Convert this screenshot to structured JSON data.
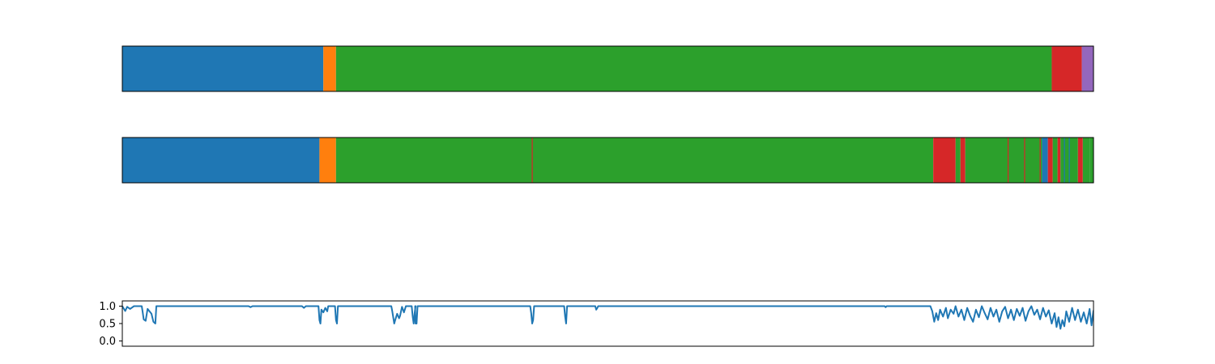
{
  "colors": {
    "blue": "#1f77b4",
    "orange": "#ff7f0e",
    "green": "#2ca02c",
    "red": "#d62728",
    "purple": "#9467bd",
    "frame": "#000000"
  },
  "chart_data": [
    {
      "type": "state-sequence",
      "xlim": [
        0,
        1
      ],
      "segments": [
        {
          "start": 0.0,
          "end": 0.207,
          "color": "blue"
        },
        {
          "start": 0.207,
          "end": 0.22,
          "color": "orange"
        },
        {
          "start": 0.22,
          "end": 0.957,
          "color": "green"
        },
        {
          "start": 0.957,
          "end": 0.988,
          "color": "red"
        },
        {
          "start": 0.988,
          "end": 1.0,
          "color": "purple"
        }
      ],
      "axes_visible": false
    },
    {
      "type": "state-sequence",
      "xlim": [
        0,
        1
      ],
      "segments": [
        {
          "start": 0.0,
          "end": 0.203,
          "color": "blue"
        },
        {
          "start": 0.203,
          "end": 0.22,
          "color": "orange"
        },
        {
          "start": 0.22,
          "end": 0.835,
          "color": "green"
        },
        {
          "start": 0.835,
          "end": 0.858,
          "color": "red"
        },
        {
          "start": 0.858,
          "end": 0.863,
          "color": "green"
        },
        {
          "start": 0.863,
          "end": 0.868,
          "color": "red"
        },
        {
          "start": 0.868,
          "end": 0.947,
          "color": "green"
        },
        {
          "start": 0.947,
          "end": 0.953,
          "color": "blue"
        },
        {
          "start": 0.953,
          "end": 0.958,
          "color": "red"
        },
        {
          "start": 0.958,
          "end": 0.963,
          "color": "green"
        },
        {
          "start": 0.963,
          "end": 0.966,
          "color": "red"
        },
        {
          "start": 0.966,
          "end": 0.984,
          "color": "green"
        },
        {
          "start": 0.984,
          "end": 0.989,
          "color": "red"
        },
        {
          "start": 0.989,
          "end": 0.996,
          "color": "green"
        },
        {
          "start": 0.996,
          "end": 1.0,
          "color": "green"
        }
      ],
      "thin_marks": [
        {
          "x": 0.422,
          "color": "red"
        },
        {
          "x": 0.912,
          "color": "red"
        },
        {
          "x": 0.929,
          "color": "red"
        },
        {
          "x": 0.945,
          "color": "red"
        },
        {
          "x": 0.97,
          "color": "blue"
        },
        {
          "x": 0.975,
          "color": "blue"
        }
      ],
      "axes_visible": false
    },
    {
      "type": "line",
      "xlim": [
        0,
        1
      ],
      "ylim": [
        -0.15,
        1.15
      ],
      "yticks": [
        "0.0",
        "0.5",
        "1.0"
      ],
      "ytick_values": [
        0.0,
        0.5,
        1.0
      ],
      "series": [
        {
          "color": "blue",
          "points": [
            [
              0.0,
              1.0
            ],
            [
              0.003,
              0.86
            ],
            [
              0.005,
              0.98
            ],
            [
              0.008,
              0.92
            ],
            [
              0.012,
              1.0
            ],
            [
              0.02,
              1.0
            ],
            [
              0.021,
              0.82
            ],
            [
              0.022,
              0.62
            ],
            [
              0.024,
              0.58
            ],
            [
              0.026,
              0.92
            ],
            [
              0.03,
              0.78
            ],
            [
              0.032,
              0.55
            ],
            [
              0.034,
              0.5
            ],
            [
              0.035,
              1.0
            ],
            [
              0.13,
              1.0
            ],
            [
              0.132,
              0.97
            ],
            [
              0.134,
              1.0
            ],
            [
              0.185,
              1.0
            ],
            [
              0.187,
              0.95
            ],
            [
              0.189,
              1.0
            ],
            [
              0.202,
              1.0
            ],
            [
              0.203,
              0.6
            ],
            [
              0.204,
              0.5
            ],
            [
              0.205,
              0.9
            ],
            [
              0.207,
              0.82
            ],
            [
              0.209,
              0.95
            ],
            [
              0.211,
              0.85
            ],
            [
              0.212,
              1.0
            ],
            [
              0.219,
              1.0
            ],
            [
              0.22,
              0.6
            ],
            [
              0.221,
              0.5
            ],
            [
              0.222,
              1.0
            ],
            [
              0.277,
              1.0
            ],
            [
              0.278,
              0.85
            ],
            [
              0.28,
              0.5
            ],
            [
              0.281,
              0.6
            ],
            [
              0.283,
              0.78
            ],
            [
              0.285,
              0.65
            ],
            [
              0.286,
              0.72
            ],
            [
              0.288,
              0.98
            ],
            [
              0.29,
              0.82
            ],
            [
              0.292,
              1.0
            ],
            [
              0.298,
              1.0
            ],
            [
              0.299,
              0.7
            ],
            [
              0.3,
              0.5
            ],
            [
              0.301,
              0.8
            ],
            [
              0.302,
              1.0
            ],
            [
              0.3015,
              1.0
            ],
            [
              0.302,
              0.5
            ],
            [
              0.303,
              0.5
            ],
            [
              0.304,
              1.0
            ],
            [
              0.42,
              1.0
            ],
            [
              0.421,
              0.8
            ],
            [
              0.422,
              0.5
            ],
            [
              0.423,
              0.6
            ],
            [
              0.424,
              1.0
            ],
            [
              0.455,
              1.0
            ],
            [
              0.456,
              0.7
            ],
            [
              0.457,
              0.5
            ],
            [
              0.458,
              1.0
            ],
            [
              0.487,
              1.0
            ],
            [
              0.488,
              0.9
            ],
            [
              0.489,
              0.94
            ],
            [
              0.49,
              1.0
            ],
            [
              0.785,
              1.0
            ],
            [
              0.786,
              0.97
            ],
            [
              0.787,
              1.0
            ],
            [
              0.832,
              1.0
            ],
            [
              0.834,
              0.85
            ],
            [
              0.836,
              0.55
            ],
            [
              0.838,
              0.8
            ],
            [
              0.84,
              0.6
            ],
            [
              0.842,
              0.9
            ],
            [
              0.845,
              0.7
            ],
            [
              0.848,
              0.95
            ],
            [
              0.85,
              0.65
            ],
            [
              0.853,
              0.9
            ],
            [
              0.856,
              0.78
            ],
            [
              0.858,
              1.0
            ],
            [
              0.861,
              0.7
            ],
            [
              0.864,
              0.9
            ],
            [
              0.867,
              0.6
            ],
            [
              0.87,
              0.95
            ],
            [
              0.873,
              0.72
            ],
            [
              0.876,
              0.55
            ],
            [
              0.879,
              0.9
            ],
            [
              0.882,
              0.68
            ],
            [
              0.885,
              1.0
            ],
            [
              0.888,
              0.8
            ],
            [
              0.891,
              0.62
            ],
            [
              0.894,
              0.95
            ],
            [
              0.897,
              0.7
            ],
            [
              0.9,
              0.9
            ],
            [
              0.903,
              0.55
            ],
            [
              0.906,
              0.85
            ],
            [
              0.909,
              0.98
            ],
            [
              0.912,
              0.65
            ],
            [
              0.915,
              0.9
            ],
            [
              0.918,
              0.6
            ],
            [
              0.921,
              0.92
            ],
            [
              0.924,
              0.72
            ],
            [
              0.927,
              0.95
            ],
            [
              0.93,
              0.58
            ],
            [
              0.933,
              0.85
            ],
            [
              0.936,
              1.0
            ],
            [
              0.939,
              0.75
            ],
            [
              0.942,
              0.9
            ],
            [
              0.945,
              0.62
            ],
            [
              0.948,
              0.95
            ],
            [
              0.951,
              0.7
            ],
            [
              0.954,
              0.88
            ],
            [
              0.957,
              0.5
            ],
            [
              0.96,
              0.8
            ],
            [
              0.962,
              0.4
            ],
            [
              0.964,
              0.68
            ],
            [
              0.966,
              0.35
            ],
            [
              0.968,
              0.6
            ],
            [
              0.97,
              0.42
            ],
            [
              0.972,
              0.85
            ],
            [
              0.975,
              0.55
            ],
            [
              0.978,
              0.95
            ],
            [
              0.981,
              0.6
            ],
            [
              0.984,
              0.9
            ],
            [
              0.987,
              0.55
            ],
            [
              0.99,
              0.82
            ],
            [
              0.993,
              0.5
            ],
            [
              0.996,
              0.92
            ],
            [
              0.998,
              0.45
            ],
            [
              1.0,
              0.88
            ]
          ]
        }
      ],
      "axes_visible": true
    }
  ]
}
